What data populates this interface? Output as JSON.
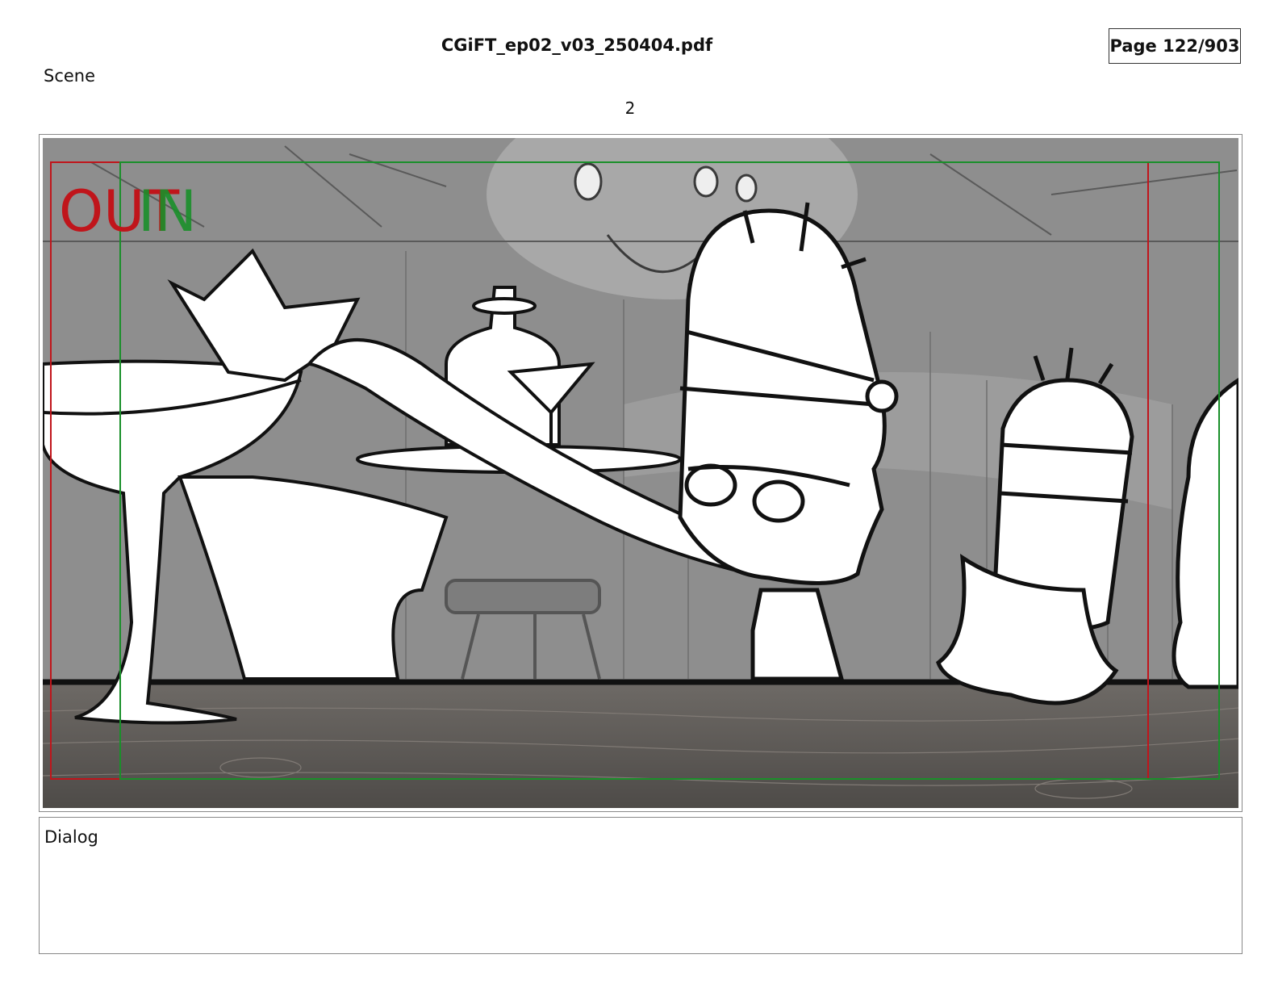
{
  "document": {
    "file_name": "CGiFT_ep02_v03_250404.pdf",
    "page_indicator": "Page 122/903"
  },
  "scene": {
    "label": "Scene",
    "number": "2"
  },
  "panel": {
    "out_marker": "OUT",
    "in_marker": "IN",
    "colors": {
      "out_frame": "#c0151b",
      "in_frame": "#1a8f2a",
      "background": "#8e8e8e",
      "counter": "#5e5a57"
    }
  },
  "dialog": {
    "label": "Dialog"
  }
}
